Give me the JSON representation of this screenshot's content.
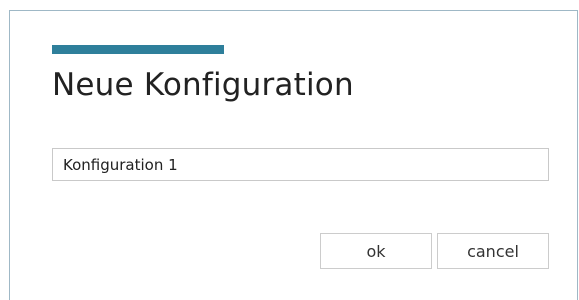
{
  "dialog": {
    "title": "Neue Konfiguration",
    "accent_color": "#2e7f9b",
    "name_input": {
      "value": "Konfiguration 1"
    },
    "buttons": {
      "ok_label": "ok",
      "cancel_label": "cancel"
    }
  }
}
